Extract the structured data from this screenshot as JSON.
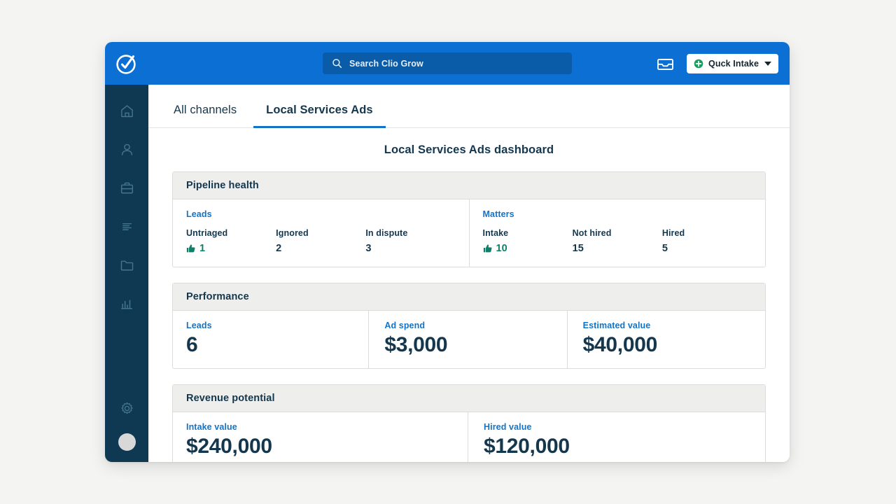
{
  "header": {
    "logo_icon": "clio-check-logo",
    "search": {
      "icon": "search-icon",
      "placeholder": "Search Clio Grow"
    },
    "inbox_icon": "inbox-icon",
    "intake_button": {
      "icon": "plus-circle-icon",
      "label": "Quck Intake",
      "caret": "chevron-down-icon"
    }
  },
  "sidebar": {
    "items": [
      {
        "icon": "home-icon",
        "name": "sidebar-item-home"
      },
      {
        "icon": "person-icon",
        "name": "sidebar-item-contacts"
      },
      {
        "icon": "briefcase-icon",
        "name": "sidebar-item-matters"
      },
      {
        "icon": "document-lines-icon",
        "name": "sidebar-item-documents"
      },
      {
        "icon": "folder-icon",
        "name": "sidebar-item-files"
      },
      {
        "icon": "bar-chart-icon",
        "name": "sidebar-item-reports"
      }
    ],
    "settings": {
      "icon": "gear-icon",
      "name": "sidebar-item-settings"
    },
    "avatar": {
      "name": "user-avatar"
    }
  },
  "tabs": [
    {
      "label": "All channels",
      "active": false
    },
    {
      "label": "Local Services Ads",
      "active": true
    }
  ],
  "main": {
    "page_title": "Local Services Ads dashboard",
    "pipeline_health": {
      "title": "Pipeline health",
      "groups": [
        {
          "title": "Leads",
          "stats": [
            {
              "label": "Untriaged",
              "value": "1",
              "icon": "thumbs-up-icon",
              "highlight": true
            },
            {
              "label": "Ignored",
              "value": "2",
              "icon": "",
              "highlight": false
            },
            {
              "label": "In dispute",
              "value": "3",
              "icon": "",
              "highlight": false
            }
          ]
        },
        {
          "title": "Matters",
          "stats": [
            {
              "label": "Intake",
              "value": "10",
              "icon": "thumbs-up-icon",
              "highlight": true
            },
            {
              "label": "Not hired",
              "value": "15",
              "icon": "",
              "highlight": false
            },
            {
              "label": "Hired",
              "value": "5",
              "icon": "",
              "highlight": false
            }
          ]
        }
      ]
    },
    "performance": {
      "title": "Performance",
      "metrics": [
        {
          "label": "Leads",
          "value": "6"
        },
        {
          "label": "Ad spend",
          "value": "$3,000"
        },
        {
          "label": "Estimated value",
          "value": "$40,000"
        }
      ]
    },
    "revenue_potential": {
      "title": "Revenue potential",
      "metrics": [
        {
          "label": "Intake value",
          "value": "$240,000"
        },
        {
          "label": "Hired value",
          "value": "$120,000"
        }
      ]
    }
  },
  "colors": {
    "brand_blue": "#0b6fd4",
    "sidebar_navy": "#0f3952",
    "link_blue": "#1473c6",
    "text_navy": "#14374e",
    "good_green": "#0f8068",
    "page_bg": "#f4f4f3"
  }
}
